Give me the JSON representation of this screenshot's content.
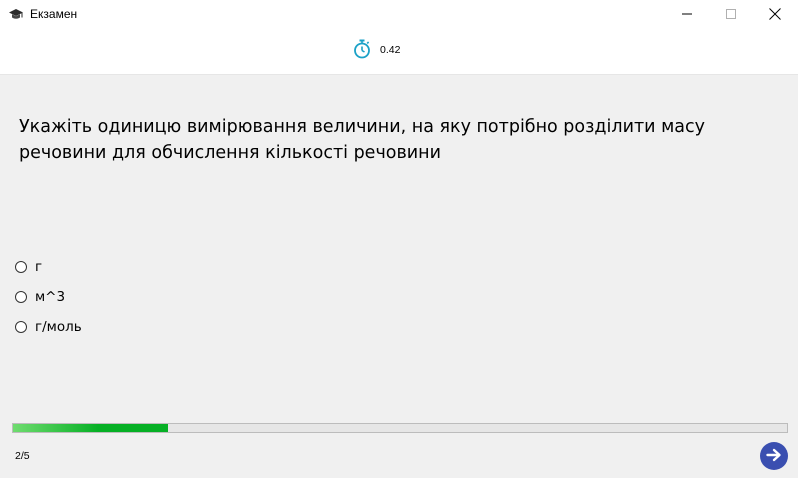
{
  "window": {
    "title": "Екзамен",
    "icon": "graduation-cap-icon"
  },
  "timer": {
    "icon": "stopwatch-icon",
    "value": "0.42",
    "color": "#1ba1c7"
  },
  "question": {
    "text": "Укажіть одиницю вимірювання величини, на яку потрібно розділити масу речовини для обчислення кількості речовини"
  },
  "options": [
    {
      "label": "г",
      "selected": false
    },
    {
      "label": "м^3",
      "selected": false
    },
    {
      "label": "г/моль",
      "selected": false
    }
  ],
  "progress": {
    "fraction": 0.2,
    "fill_color": "#06b025",
    "counter": "2/5"
  },
  "navigation": {
    "next_icon": "arrow-right-icon",
    "next_color": "#3a4fb0"
  }
}
